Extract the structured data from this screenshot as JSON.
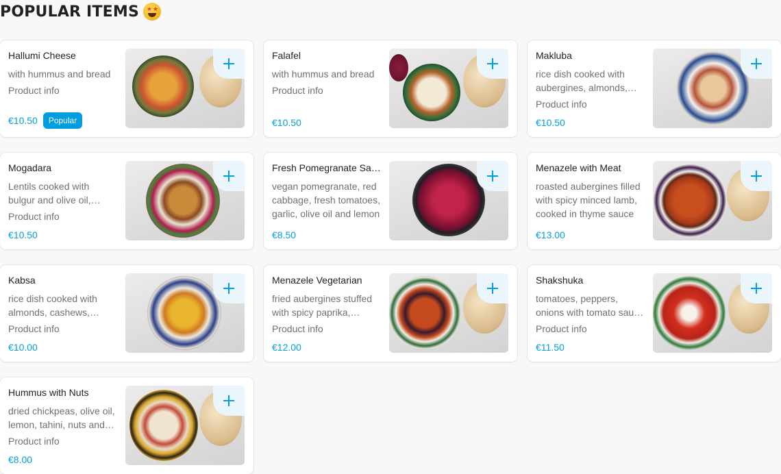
{
  "section": {
    "title": "POPULAR ITEMS",
    "emoji_icon": "star-struck-emoji-icon"
  },
  "colors": {
    "accent": "#009de0",
    "card_bg": "#ffffff",
    "page_bg": "#f8f8f8"
  },
  "items": [
    {
      "name": "Hallumi Cheese",
      "description": "with hummus and bread",
      "info": "Product info",
      "price": "€10.50",
      "badge": "Popular"
    },
    {
      "name": "Falafel",
      "description": "with hummus and bread",
      "info": "Product info",
      "price": "€10.50"
    },
    {
      "name": "Makluba",
      "description": "rice dish cooked with aubergines, almonds, cashews and pine nuts",
      "info": "Product info",
      "price": "€10.50"
    },
    {
      "name": "Mogadara",
      "description": "Lentils cooked with bulgur and olive oil, served with fried onions",
      "info": "Product info",
      "price": "€10.50"
    },
    {
      "name": "Fresh Pomegranate Salad",
      "description": "vegan pomegranate, red cabbage, fresh tomatoes, garlic, olive oil and lemon",
      "info": "",
      "price": "€8.50"
    },
    {
      "name": "Menazele with Meat",
      "description": "roasted aubergines filled with spicy minced lamb, cooked in thyme sauce",
      "info": "",
      "price": "€13.00"
    },
    {
      "name": "Kabsa",
      "description": "rice dish cooked with almonds, cashews, raisins and spices",
      "info": "Product info",
      "price": "€10.00"
    },
    {
      "name": "Menazele Vegetarian",
      "description": "fried aubergines stuffed with spicy paprika, tomatoes and onions",
      "info": "Product info",
      "price": "€12.00"
    },
    {
      "name": "Shakshuka",
      "description": "tomatoes, peppers, onions with tomato sauce and eggs",
      "info": "Product info",
      "price": "€11.50"
    },
    {
      "name": "Hummus with Nuts",
      "description": "dried chickpeas, olive oil, lemon, tahini, nuts and spices",
      "info": "Product info",
      "price": "€8.00"
    }
  ]
}
